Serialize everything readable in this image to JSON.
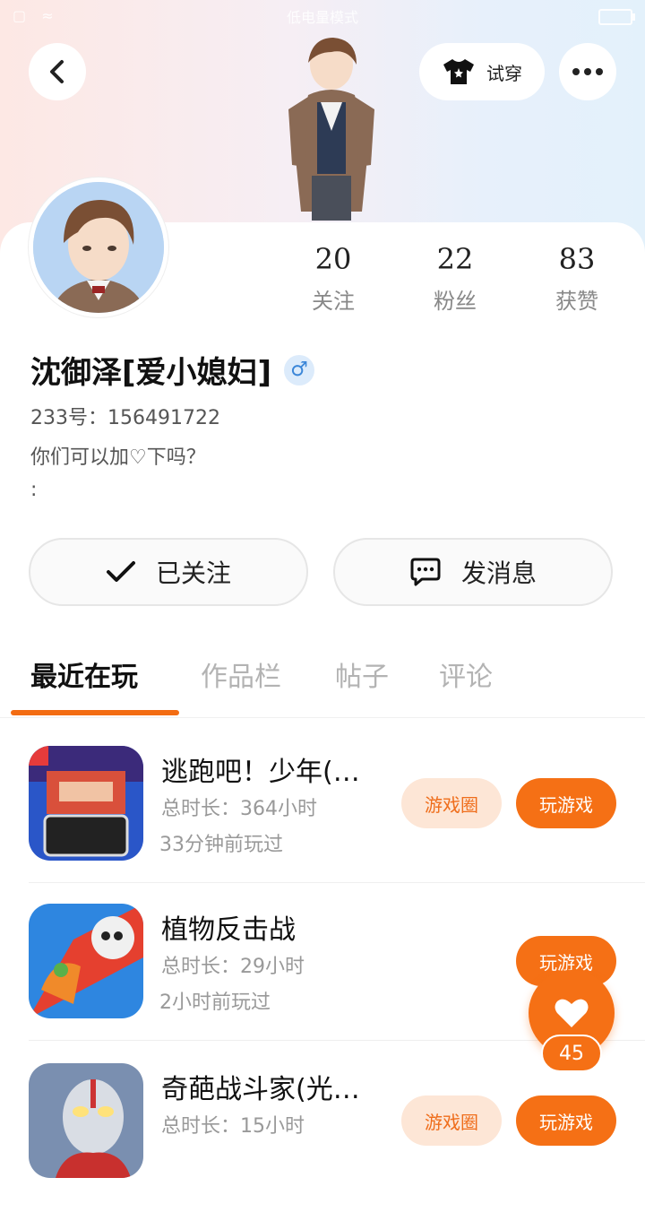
{
  "status_bar": {
    "center_text": "低电量模式"
  },
  "header": {
    "back_icon": "chevron-left-icon",
    "try_on_label": "试穿",
    "more_icon": "more-horizontal-icon"
  },
  "profile": {
    "name": "沈御泽[爱小媳妇]",
    "gender_symbol": "♂",
    "id_line": "233号：156491722",
    "bio": "你们可以加♡下吗？",
    "bio_extra": ":",
    "stats": [
      {
        "value": "20",
        "label": "关注"
      },
      {
        "value": "22",
        "label": "粉丝"
      },
      {
        "value": "83",
        "label": "获赞"
      }
    ]
  },
  "actions": {
    "follow_label": "已关注",
    "message_label": "发消息"
  },
  "tabs": [
    {
      "label": "最近在玩",
      "active": true
    },
    {
      "label": "作品栏",
      "active": false
    },
    {
      "label": "帖子",
      "active": false
    },
    {
      "label": "评论",
      "active": false
    }
  ],
  "games": [
    {
      "title": "逃跑吧！少年(…",
      "duration": "总时长：364小时",
      "last_played": "33分钟前玩过",
      "circle_label": "游戏圈",
      "play_label": "玩游戏"
    },
    {
      "title": "植物反击战",
      "duration": "总时长：29小时",
      "last_played": "2小时前玩过",
      "circle_label": "",
      "play_label": "玩游戏"
    },
    {
      "title": "奇葩战斗家(光…",
      "duration": "总时长：15小时",
      "last_played": "",
      "circle_label": "游戏圈",
      "play_label": "玩游戏"
    }
  ],
  "like": {
    "count": "45"
  },
  "colors": {
    "accent": "#f57015",
    "accent_light": "#fde6d6"
  }
}
